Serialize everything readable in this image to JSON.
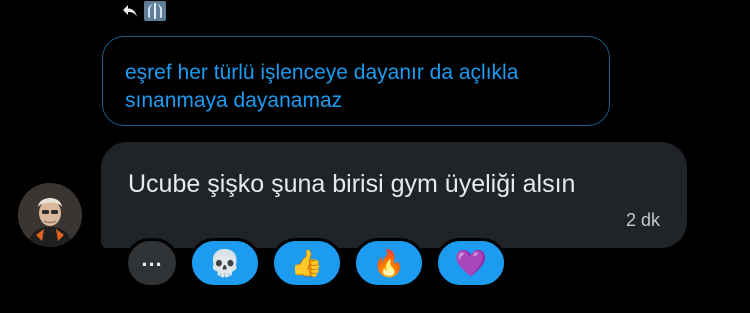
{
  "reply_indicator": {
    "arrow_icon": "reply-arrow-icon",
    "thumbnail_icon": "xray-image-icon"
  },
  "quoted_message": {
    "text": "eşref her türlü işlenceye dayanır da açlıkla sınanmaya dayanamaz"
  },
  "message": {
    "text": "Ucube şişko şuna birisi gym üyeliği alsın",
    "timestamp": "2 dk"
  },
  "reactions": {
    "more_label": "...",
    "items": [
      {
        "emoji": "💀",
        "name": "skull"
      },
      {
        "emoji": "👍",
        "name": "thumbs-up"
      },
      {
        "emoji": "🔥",
        "name": "fire"
      },
      {
        "emoji": "💜",
        "name": "purple-heart"
      }
    ]
  },
  "colors": {
    "background": "#000000",
    "accent": "#1d9bf0",
    "bubble": "#202327",
    "text": "#e7e9ea"
  }
}
